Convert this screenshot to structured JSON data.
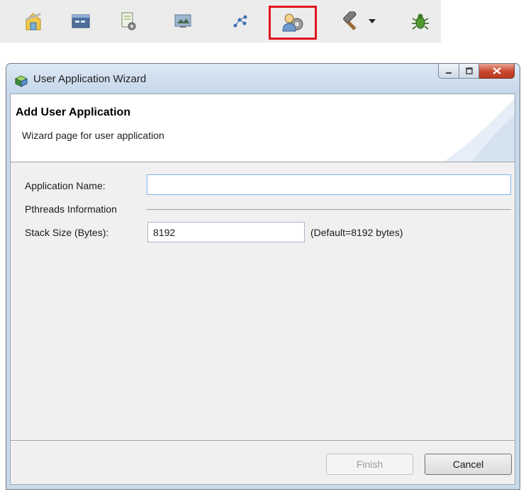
{
  "toolbar": {
    "items": [
      {
        "icon": "home-builder-icon"
      },
      {
        "icon": "terminal-window-icon"
      },
      {
        "icon": "document-gear-icon"
      },
      {
        "icon": "monitor-screen-icon"
      },
      {
        "icon": "network-nodes-icon"
      },
      {
        "icon": "user-application-gear-icon",
        "active": true
      },
      {
        "icon": "hammer-build-icon",
        "has_dropdown": true
      },
      {
        "icon": "bug-debug-icon"
      }
    ],
    "highlight_color": "#e0141e"
  },
  "dialog": {
    "title": "User Application Wizard",
    "header_title": "Add User Application",
    "header_description": "Wizard page for user application",
    "app_name_label": "Application Name:",
    "app_name_value": "",
    "pthreads_group_label": "Pthreads Information",
    "stack_size_label": "Stack Size (Bytes):",
    "stack_size_value": "8192",
    "stack_size_hint": "(Default=8192 bytes)",
    "finish_label": "Finish",
    "cancel_label": "Cancel",
    "finish_enabled": false
  }
}
